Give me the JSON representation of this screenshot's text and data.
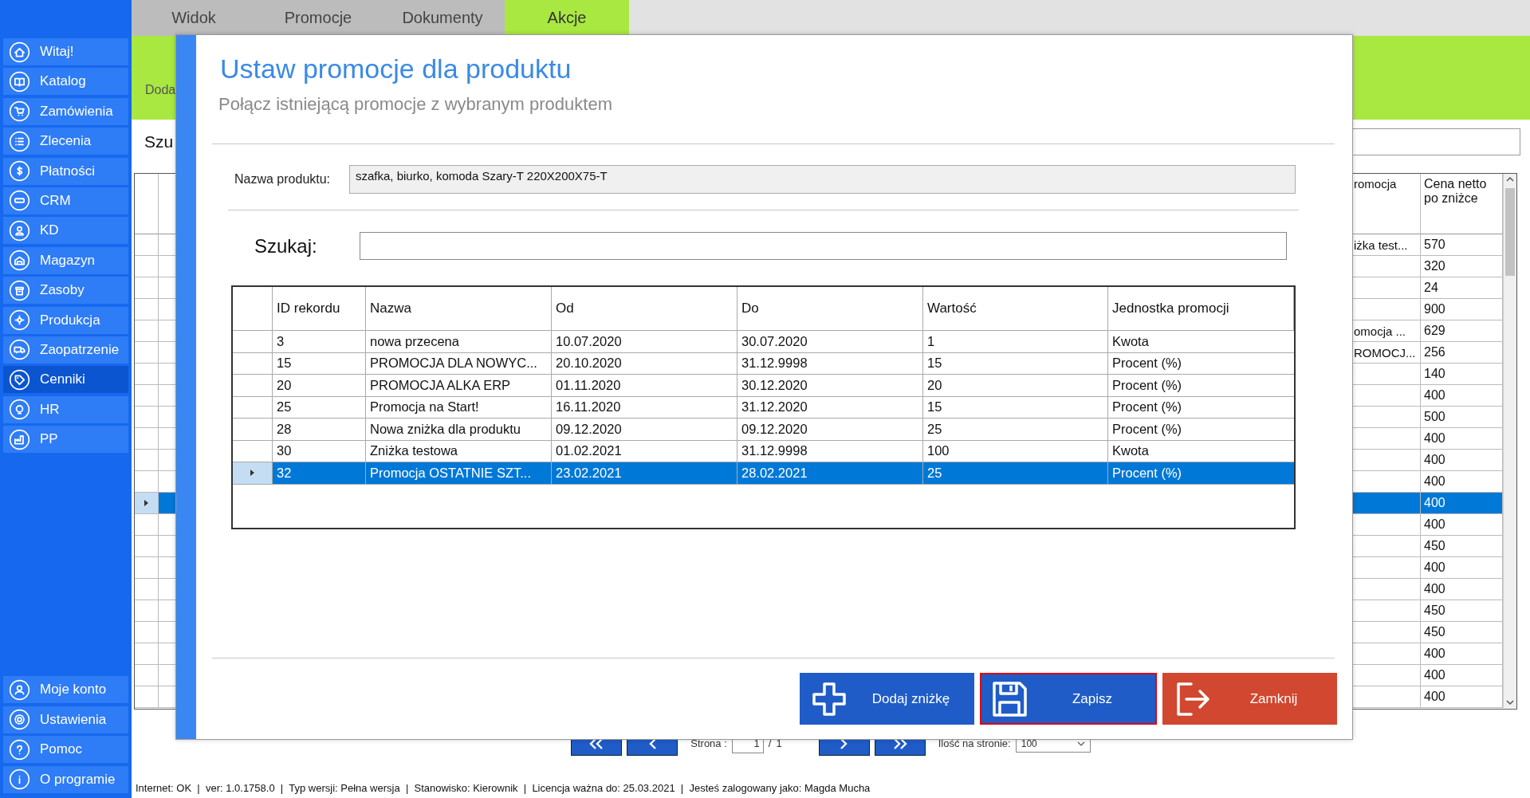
{
  "sidebar": {
    "items": [
      {
        "label": "Witaj!",
        "selected": false
      },
      {
        "label": "Katalog",
        "selected": false
      },
      {
        "label": "Zamówienia",
        "selected": false
      },
      {
        "label": "Zlecenia",
        "selected": false
      },
      {
        "label": "Płatności",
        "selected": false
      },
      {
        "label": "CRM",
        "selected": false
      },
      {
        "label": "KD",
        "selected": false
      },
      {
        "label": "Magazyn",
        "selected": false
      },
      {
        "label": "Zasoby",
        "selected": false
      },
      {
        "label": "Produkcja",
        "selected": false
      },
      {
        "label": "Zaopatrzenie",
        "selected": false
      },
      {
        "label": "Cenniki",
        "selected": true
      },
      {
        "label": "HR",
        "selected": false
      },
      {
        "label": "PP",
        "selected": false
      }
    ],
    "bottom_items": [
      {
        "label": "Moje konto",
        "selected": false
      },
      {
        "label": "Ustawienia",
        "selected": false
      },
      {
        "label": "Pomoc",
        "selected": false
      },
      {
        "label": "O programie",
        "selected": false
      }
    ]
  },
  "tabs": [
    {
      "label": "Widok",
      "selected": false
    },
    {
      "label": "Promocje",
      "selected": false
    },
    {
      "label": "Dokumenty",
      "selected": false
    },
    {
      "label": "Akcje",
      "selected": true
    }
  ],
  "ribbon": {
    "label": "Doda"
  },
  "search": {
    "label": "Szu"
  },
  "background_table": {
    "columns": [
      "romocja",
      "Cena netto po zniżce"
    ],
    "rows": [
      {
        "cells": [
          "iżka test...",
          "570"
        ],
        "selected": false
      },
      {
        "cells": [
          "",
          "320"
        ],
        "selected": false
      },
      {
        "cells": [
          "",
          "24"
        ],
        "selected": false
      },
      {
        "cells": [
          "",
          "900"
        ],
        "selected": false
      },
      {
        "cells": [
          "omocja ...",
          "629"
        ],
        "selected": false
      },
      {
        "cells": [
          "ROMOCJ...",
          "256"
        ],
        "selected": false
      },
      {
        "cells": [
          "",
          "140"
        ],
        "selected": false
      },
      {
        "cells": [
          "",
          "400"
        ],
        "selected": false
      },
      {
        "cells": [
          "",
          "500"
        ],
        "selected": false
      },
      {
        "cells": [
          "",
          "400"
        ],
        "selected": false
      },
      {
        "cells": [
          "",
          "400"
        ],
        "selected": false
      },
      {
        "cells": [
          "",
          "400"
        ],
        "selected": false
      },
      {
        "cells": [
          "",
          "400"
        ],
        "selected": true
      },
      {
        "cells": [
          "",
          "400"
        ],
        "selected": false
      },
      {
        "cells": [
          "",
          "450"
        ],
        "selected": false
      },
      {
        "cells": [
          "",
          "400"
        ],
        "selected": false
      },
      {
        "cells": [
          "",
          "400"
        ],
        "selected": false
      },
      {
        "cells": [
          "",
          "450"
        ],
        "selected": false
      },
      {
        "cells": [
          "",
          "450"
        ],
        "selected": false
      },
      {
        "cells": [
          "",
          "400"
        ],
        "selected": false
      },
      {
        "cells": [
          "",
          "400"
        ],
        "selected": false
      },
      {
        "cells": [
          "",
          "400"
        ],
        "selected": false
      }
    ]
  },
  "pager": {
    "page_label": "Strona :",
    "page": "1",
    "separator": "/",
    "page_count": "1",
    "per_page_label": "Ilość na stronie:",
    "per_page": "100"
  },
  "dialog": {
    "title": "Ustaw promocje dla produktu",
    "subtitle": "Połącz istniejącą promocje z wybranym produktem",
    "product": {
      "label": "Nazwa produktu:",
      "value": "szafka, biurko, komoda Szary-T 220X200X75-T"
    },
    "search": {
      "label": "Szukaj:"
    },
    "table": {
      "columns": [
        "ID rekordu",
        "Nazwa",
        "Od",
        "Do",
        "Wartość",
        "Jednostka promocji"
      ],
      "rows": [
        {
          "cells": [
            "3",
            "nowa przecena",
            "10.07.2020",
            "30.07.2020",
            "1",
            "Kwota"
          ],
          "selected": false
        },
        {
          "cells": [
            "15",
            "PROMOCJA DLA NOWYC...",
            "20.10.2020",
            "31.12.9998",
            "15",
            "Procent (%)"
          ],
          "selected": false
        },
        {
          "cells": [
            "20",
            "PROMOCJA ALKA ERP",
            "01.11.2020",
            "30.12.2020",
            "20",
            "Procent (%)"
          ],
          "selected": false
        },
        {
          "cells": [
            "25",
            "Promocja na Start!",
            "16.11.2020",
            "31.12.2020",
            "15",
            "Procent (%)"
          ],
          "selected": false
        },
        {
          "cells": [
            "28",
            "Nowa zniżka dla produktu",
            "09.12.2020",
            "09.12.2020",
            "25",
            "Procent (%)"
          ],
          "selected": false
        },
        {
          "cells": [
            "30",
            "Zniżka testowa",
            "01.02.2021",
            "31.12.9998",
            "100",
            "Kwota"
          ],
          "selected": false
        },
        {
          "cells": [
            "32",
            "Promocja OSTATNIE SZT...",
            "23.02.2021",
            "28.02.2021",
            "25",
            "Procent (%)"
          ],
          "selected": true
        }
      ]
    },
    "buttons": [
      {
        "label": "Dodaj zniżkę",
        "kind": "add",
        "focused": false
      },
      {
        "label": "Zapisz",
        "kind": "save",
        "focused": true
      },
      {
        "label": "Zamknij",
        "kind": "close",
        "focused": false
      }
    ]
  },
  "status_bar": "Internet: OK  |  ver: 1.0.1758.0  |  Typ wersji: Pełna wersja  |  Stanowisko: Kierownik  |  Licencja ważna do: 25.03.2021  |  Jesteś zalogowany jako: Magda Mucha"
}
